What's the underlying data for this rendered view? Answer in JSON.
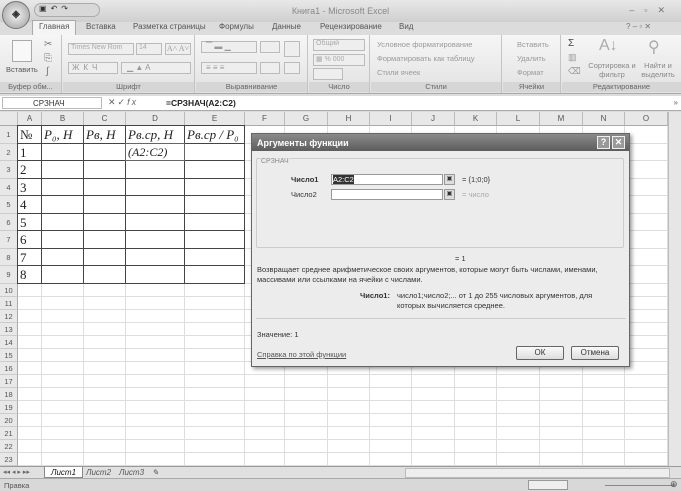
{
  "app": {
    "title": "Книга1 - Microsoft Excel",
    "office_button": "⊞"
  },
  "ribbon_tabs": [
    "Главная",
    "Вставка",
    "Разметка страницы",
    "Формулы",
    "Данные",
    "Рецензирование",
    "Вид"
  ],
  "ribbon": {
    "clipboard": {
      "paste": "Вставить",
      "label": "Буфер обм..."
    },
    "font": {
      "name": "Times New Rom",
      "size": "14",
      "label": "Шрифт"
    },
    "alignment": {
      "label": "Выравнивание"
    },
    "number": {
      "format": "Общий",
      "label": "Число"
    },
    "styles": {
      "conditional": "Условное форматирование",
      "as_table": "Форматировать как таблицу",
      "cell_styles": "Стили ячеек",
      "label": "Стили"
    },
    "cells": {
      "insert": "Вставить",
      "delete": "Удалить",
      "format": "Формат",
      "label": "Ячейки"
    },
    "editing": {
      "sum": "Σ",
      "sort": "Сортировка и фильтр",
      "find": "Найти и выделить",
      "label": "Редактирование"
    }
  },
  "formula_bar": {
    "name_box": "СРЗНАЧ",
    "fx": "fx",
    "formula": "=СРЗНАЧ(A2:C2)"
  },
  "columns": [
    "A",
    "B",
    "C",
    "D",
    "E",
    "F",
    "G",
    "H",
    "I",
    "J",
    "K",
    "L",
    "M",
    "N",
    "O"
  ],
  "rows": [
    "1",
    "2",
    "3",
    "4",
    "5",
    "6",
    "7",
    "8",
    "9",
    "10",
    "11",
    "12",
    "13",
    "14",
    "15",
    "16",
    "17",
    "18",
    "19",
    "20",
    "21",
    "22",
    "23"
  ],
  "table": {
    "headers": [
      "№",
      "P₀, Н",
      "Pв, Н",
      "Pв.ср, Н",
      "Pв.ср / P₀"
    ],
    "col_a": [
      "1",
      "2",
      "3",
      "4",
      "5",
      "6",
      "7",
      "8"
    ],
    "d2_edit": "(A2:C2)"
  },
  "dialog": {
    "title": "Аргументы функции",
    "function": "СРЗНАЧ",
    "arg1_label": "Число1",
    "arg1_value": "A2:C2",
    "arg1_result": "= {1;0;0}",
    "arg2_label": "Число2",
    "arg2_value": "",
    "arg2_result": "= число",
    "result": "= 1",
    "description": "Возвращает среднее арифметическое своих аргументов, которые могут быть числами, именами, массивами или ссылками на ячейки с числами.",
    "arg_help_label": "Число1:",
    "arg_help": "число1;число2;... от 1 до 255 числовых аргументов, для которых вычисляется среднее.",
    "value_text": "Значение:  1",
    "help_link": "Справка по этой функции",
    "ok": "ОК",
    "cancel": "Отмена"
  },
  "sheets": [
    "Лист1",
    "Лист2",
    "Лист3"
  ],
  "status": {
    "text": "Правка"
  }
}
